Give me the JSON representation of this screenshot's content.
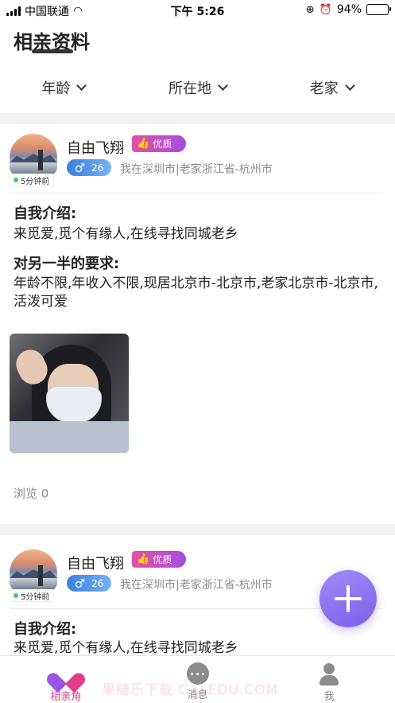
{
  "status_bar": {
    "carrier": "中国联通",
    "time": "下午 5:26",
    "battery": "94%",
    "battery_level": 0.94
  },
  "header": {
    "title": "相亲资料"
  },
  "filters": [
    {
      "label": "年龄"
    },
    {
      "label": "所在地"
    },
    {
      "label": "老家"
    }
  ],
  "posts": [
    {
      "online": "5分钟前",
      "name": "自由飞翔",
      "badge": "优质",
      "gender_symbol": "♂",
      "age": "26",
      "location": "我在深圳市|老家浙江省-杭州市",
      "intro_title": "自我介绍:",
      "intro_text": "来觅爱,觅个有缘人,在线寻找同城老乡",
      "req_title": "对另一半的要求:",
      "req_text": "年龄不限,年收入不限,现居北京市-北京市,老家北京市-北京市,活泼可爱",
      "views": "浏览 0"
    },
    {
      "online": "5分钟前",
      "name": "自由飞翔",
      "badge": "优质",
      "gender_symbol": "♂",
      "age": "26",
      "location": "我在深圳市|老家浙江省-杭州市",
      "intro_title": "自我介绍:",
      "intro_text": "来觅爱,觅个有缘人,在线寻找同城老乡"
    }
  ],
  "tabbar": {
    "items": [
      {
        "label": "相亲角",
        "icon": "hearts-icon",
        "active": true
      },
      {
        "label": "消息",
        "icon": "chat-icon",
        "active": false
      },
      {
        "label": "我",
        "icon": "person-icon",
        "active": false
      }
    ]
  },
  "watermark": "果糖乐下载 GXLEDU.COM",
  "colors": {
    "accent": "#e23d8a",
    "fab": "#8b73ee",
    "male_badge": "#4a8ce8",
    "vip_start": "#e44fa5",
    "vip_end": "#a44ee0"
  }
}
